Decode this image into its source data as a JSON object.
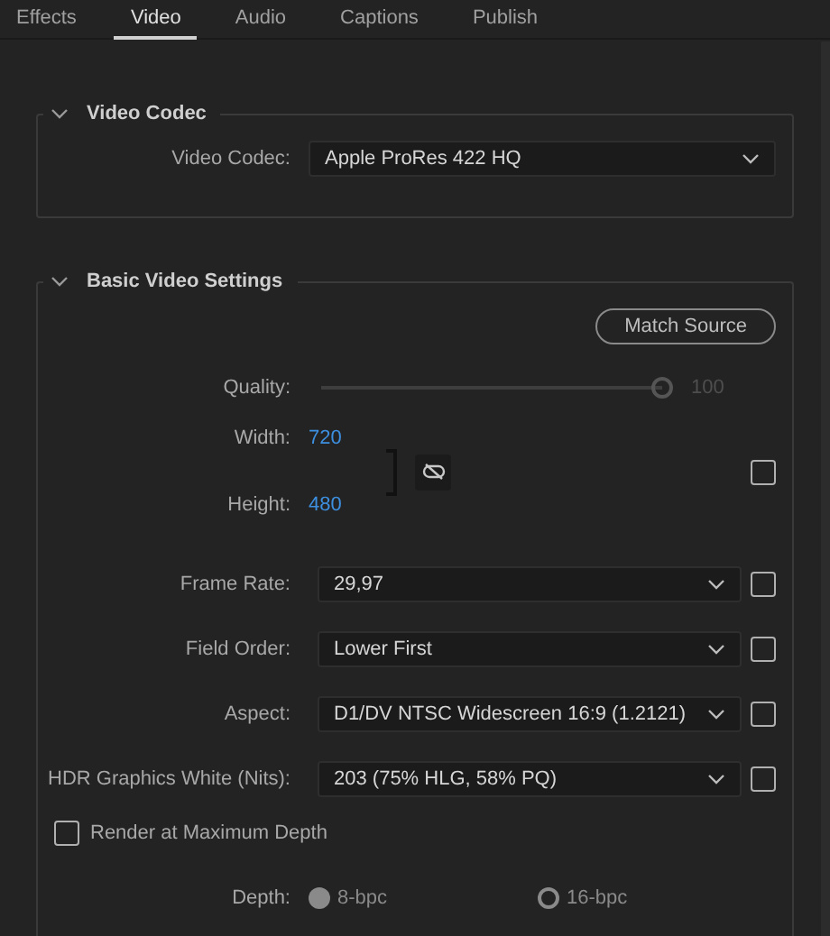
{
  "tabs": [
    {
      "label": "Effects",
      "selected": false
    },
    {
      "label": "Video",
      "selected": true
    },
    {
      "label": "Audio",
      "selected": false
    },
    {
      "label": "Captions",
      "selected": false
    },
    {
      "label": "Publish",
      "selected": false
    }
  ],
  "video_codec_section": {
    "title": "Video Codec",
    "expanded": true,
    "codec": {
      "label": "Video Codec:",
      "value": "Apple ProRes 422 HQ"
    }
  },
  "basic_video_settings": {
    "title": "Basic Video Settings",
    "expanded": true,
    "match_source": "Match Source",
    "quality": {
      "label": "Quality:",
      "level": 1,
      "reading": "100",
      "disabled": true
    },
    "width": {
      "label": "Width:",
      "value": "720"
    },
    "height": {
      "label": "Height:",
      "value": "480"
    },
    "link_locked": false,
    "dimensions_checked": false,
    "dropdowns": [
      {
        "label": "Frame Rate:",
        "value": "29,97",
        "checked": false
      },
      {
        "label": "Field Order:",
        "value": "Lower First",
        "checked": false
      },
      {
        "label": "Aspect:",
        "value": "D1/DV NTSC Widescreen 16:9 (1.2121)",
        "checked": false
      },
      {
        "label": "HDR Graphics White (Nits):",
        "value": "203 (75% HLG, 58% PQ)",
        "checked": false
      }
    ],
    "render_max_depth": {
      "label": "Render at Maximum Depth",
      "checked": false
    },
    "depth": {
      "label": "Depth:",
      "options": [
        {
          "label": "8-bpc",
          "selected": true,
          "disabled": true
        },
        {
          "label": "16-bpc",
          "selected": false,
          "disabled": true
        }
      ]
    }
  }
}
